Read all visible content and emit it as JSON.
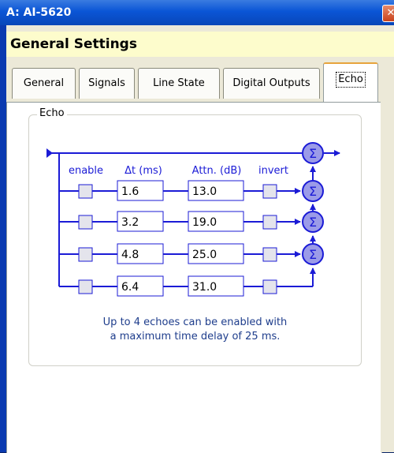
{
  "window": {
    "title": "A: AI-5620",
    "close_label": "✕"
  },
  "header": {
    "title": "General Settings"
  },
  "tabs": [
    {
      "label": "General"
    },
    {
      "label": "Signals"
    },
    {
      "label": "Line State"
    },
    {
      "label": "Digital Outputs"
    },
    {
      "label": "Echo",
      "active": true
    }
  ],
  "echo": {
    "group_title": "Echo",
    "col_enable": "enable",
    "col_dt": "Δt (ms)",
    "col_attn": "Attn. (dB)",
    "col_invert": "invert",
    "sum_symbol": "Σ",
    "rows": [
      {
        "delay": "1.6",
        "attn": "13.0",
        "enabled": false,
        "inverted": false
      },
      {
        "delay": "3.2",
        "attn": "19.0",
        "enabled": false,
        "inverted": false
      },
      {
        "delay": "4.8",
        "attn": "25.0",
        "enabled": false,
        "inverted": false
      },
      {
        "delay": "6.4",
        "attn": "31.0",
        "enabled": false,
        "inverted": false
      }
    ],
    "info_line1": "Up to 4 echoes can be enabled with",
    "info_line2": "a maximum time delay of 25 ms."
  },
  "colors": {
    "signal": "#1b1bd6",
    "sum_fill": "#9b9be8",
    "info_text": "#1e3d8c",
    "active_tab_accent": "#e7a43c"
  }
}
